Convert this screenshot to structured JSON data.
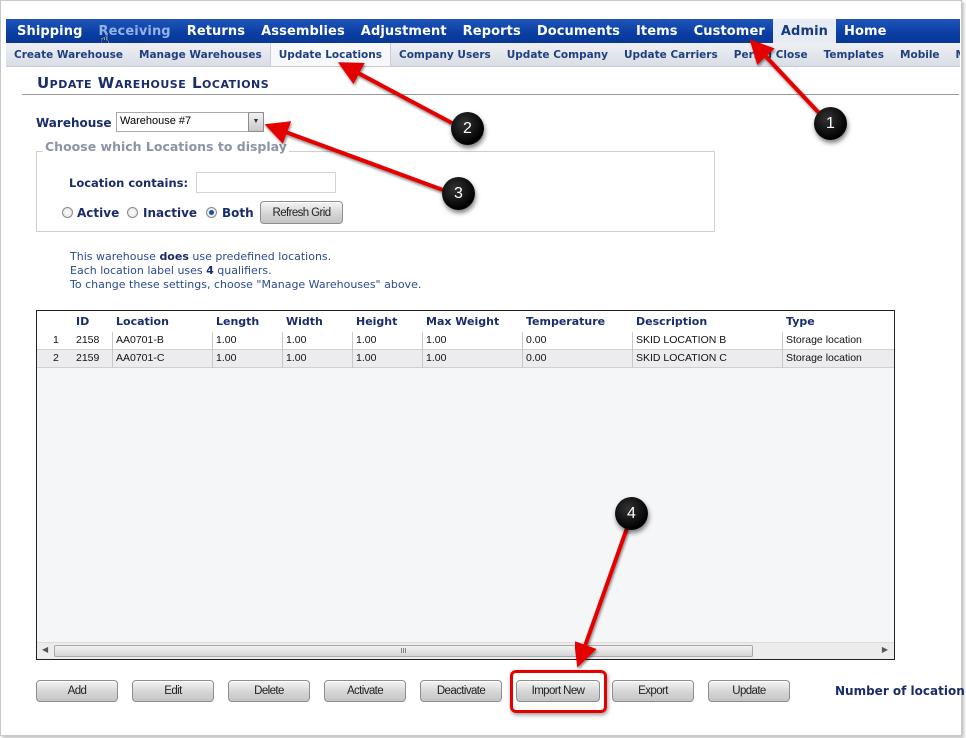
{
  "nav": {
    "top": [
      {
        "label": "Shipping"
      },
      {
        "label": "Receiving"
      },
      {
        "label": "Returns"
      },
      {
        "label": "Assemblies"
      },
      {
        "label": "Adjustment"
      },
      {
        "label": "Reports"
      },
      {
        "label": "Documents"
      },
      {
        "label": "Items"
      },
      {
        "label": "Customer"
      },
      {
        "label": "Admin"
      },
      {
        "label": "Home"
      }
    ],
    "top_active": "Admin",
    "top_hover": "Receiving",
    "sub": [
      {
        "label": "Create Warehouse"
      },
      {
        "label": "Manage Warehouses"
      },
      {
        "label": "Update Locations"
      },
      {
        "label": "Company Users"
      },
      {
        "label": "Update Company"
      },
      {
        "label": "Update Carriers"
      },
      {
        "label": "Period Close"
      },
      {
        "label": "Templates"
      },
      {
        "label": "Mobile"
      },
      {
        "label": "Movable"
      }
    ],
    "sub_active": "Update Locations"
  },
  "page": {
    "title": "Update Warehouse Locations"
  },
  "warehouse": {
    "label": "Warehouse",
    "value": "Warehouse #7"
  },
  "filter": {
    "legend": "Choose which Locations to display",
    "location_label": "Location contains:",
    "location_value": "",
    "radios": [
      {
        "label": "Active",
        "checked": false
      },
      {
        "label": "Inactive",
        "checked": false
      },
      {
        "label": "Both",
        "checked": true
      }
    ],
    "refresh_label": "Refresh Grid"
  },
  "info": {
    "line1_pre": "This warehouse ",
    "line1_bold": "does",
    "line1_post": " use predefined locations.",
    "line2_pre": "Each location label uses ",
    "line2_bold": "4",
    "line2_post": " qualifiers.",
    "line3": "To change these settings, choose \"Manage Warehouses\" above."
  },
  "grid": {
    "columns": [
      "",
      "ID",
      "Location",
      "Length",
      "Width",
      "Height",
      "Max Weight",
      "Temperature",
      "Description",
      "Type"
    ],
    "rows": [
      [
        "1",
        "2158",
        "AA0701-B",
        "1.00",
        "1.00",
        "1.00",
        "1.00",
        "0.00",
        "SKID LOCATION B",
        "Storage location"
      ],
      [
        "2",
        "2159",
        "AA0701-C",
        "1.00",
        "1.00",
        "1.00",
        "1.00",
        "0.00",
        "SKID LOCATION C",
        "Storage location"
      ]
    ],
    "scroll_grip": "III"
  },
  "actions": {
    "add": "Add",
    "edit": "Edit",
    "delete": "Delete",
    "activate": "Activate",
    "deactivate": "Deactivate",
    "import_new": "Import New",
    "export": "Export",
    "update": "Update"
  },
  "count_label": "Number of location",
  "callouts": [
    "1",
    "2",
    "3",
    "4"
  ],
  "colors": {
    "nav_blue": "#0a3ea3",
    "heading_navy": "#1a2d6b",
    "callout_red": "#e50000"
  }
}
